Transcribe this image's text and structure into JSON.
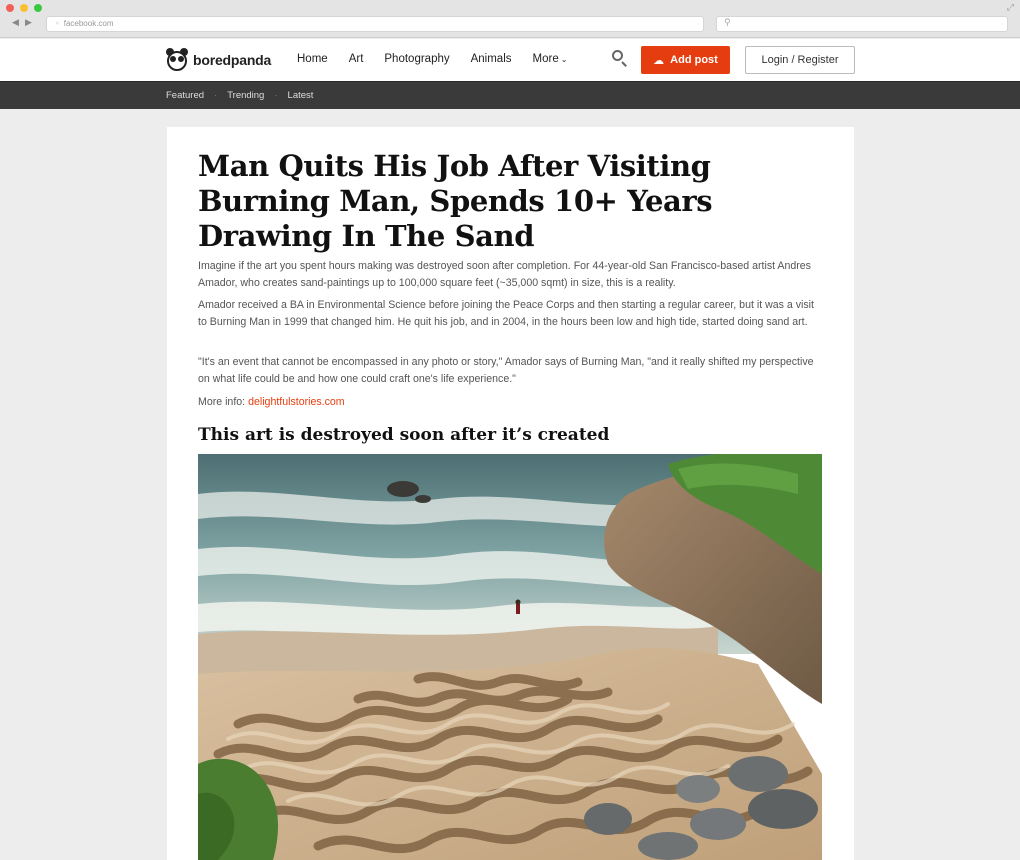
{
  "browser": {
    "url": "facebook.com",
    "back_icon": "chevron-left-icon",
    "forward_icon": "chevron-right-icon"
  },
  "header": {
    "logo_text": "boredpanda",
    "nav": [
      {
        "label": "Home"
      },
      {
        "label": "Art"
      },
      {
        "label": "Photography"
      },
      {
        "label": "Animals"
      },
      {
        "label": "More"
      }
    ],
    "add_post_label": "Add post",
    "login_label": "Login / Register",
    "accent": "#e63d10"
  },
  "subnav": {
    "items": [
      {
        "label": "Featured"
      },
      {
        "label": "Trending"
      },
      {
        "label": "Latest"
      }
    ]
  },
  "article": {
    "title": "Man Quits His Job After Visiting Burning Man, Spends 10+ Years Drawing In The Sand",
    "paragraphs": [
      "Imagine if the art you spent hours making was destroyed soon after completion. For 44-year-old San Francisco-based artist Andres Amador, who creates sand-paintings up to 100,000 square feet (~35,000 sqmt) in size, this is a reality.",
      "Amador received a BA in Environmental Science before joining the Peace Corps and then starting a regular career, but it was a visit to Burning Man in 1999 that changed him. He quit his job, and in 2004, in the hours been low and high tide, started doing sand art.",
      "\"It's an event that cannot be encompassed in any photo or story,\" Amador says of Burning Man, \"and it really shifted my perspective on what life could be and how one could craft one's life experience.\""
    ],
    "more_info_label": "More info:",
    "more_info_link": "delightfulstories.com",
    "subheading": "This art is destroyed soon after it’s created"
  }
}
